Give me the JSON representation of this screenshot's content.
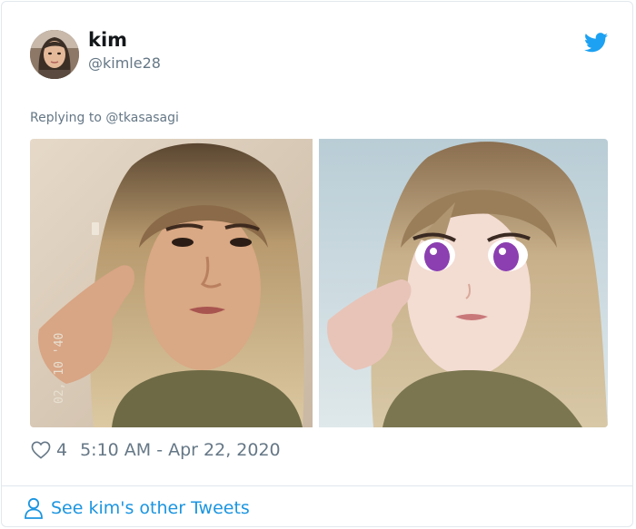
{
  "tweet": {
    "author_name": "kim",
    "author_handle": "@kimle28",
    "reply_prefix": "Replying to",
    "reply_to": "@tkasasagi",
    "like_count": "4",
    "timestamp": "5:10 AM - Apr 22, 2020",
    "photo_left_overlay": "02, 10 '40",
    "see_more_label": "See kim's other Tweets"
  },
  "colors": {
    "twitter_blue": "#1da1f2",
    "link_blue": "#1b95e0",
    "muted_gray": "#657786",
    "border": "#e1e8ed"
  },
  "icons": {
    "brand": "twitter-bird-icon",
    "like": "heart-icon",
    "profile": "person-icon"
  }
}
